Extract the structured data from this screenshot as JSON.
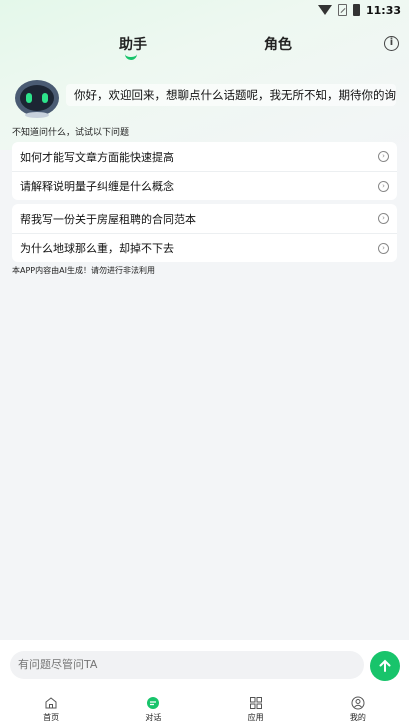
{
  "status_bar": {
    "time": "11:33",
    "icons": [
      "wifi-icon",
      "sim-icon",
      "battery-icon"
    ]
  },
  "tabs": [
    {
      "label": "助手",
      "active": true
    },
    {
      "label": "角色",
      "active": false
    }
  ],
  "header": {
    "info_icon": "info-icon"
  },
  "greeting": "你好，欢迎回来，想聊点什么话题呢，我无所不知，期待你的询问！",
  "hint": "不知道问什么，试试以下问题",
  "suggestions": [
    {
      "label": "如何才能写文章方面能快速提高"
    },
    {
      "label": "请解释说明量子纠缠是什么概念"
    },
    {
      "label": "帮我写一份关于房屋租聘的合同范本"
    },
    {
      "label": "为什么地球那么重，却掉不下去"
    }
  ],
  "disclaimer": "本APP内容由AI生成！请勿进行非法利用",
  "input": {
    "placeholder": "有问题尽管问TA"
  },
  "bottom_nav": [
    {
      "label": "首页",
      "icon": "home-icon"
    },
    {
      "label": "对话",
      "icon": "chat-icon",
      "active": true
    },
    {
      "label": "应用",
      "icon": "apps-icon"
    },
    {
      "label": "我的",
      "icon": "profile-icon"
    }
  ],
  "colors": {
    "accent": "#18c46b",
    "background": "#f3f5f7"
  }
}
